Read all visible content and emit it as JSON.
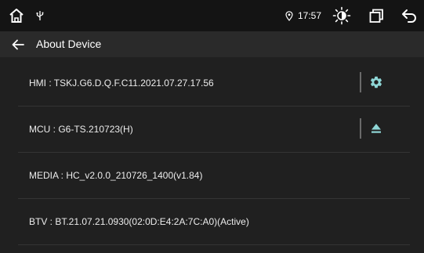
{
  "colors": {
    "status_bar_bg": "#141414",
    "title_bar_bg": "#2a2a2a",
    "page_bg": "#202020",
    "accent": "#8fd6d6",
    "divider": "#343434"
  },
  "status_bar": {
    "icons": [
      "home-icon",
      "usb-icon",
      "location-pin-icon",
      "brightness-icon",
      "recent-apps-icon",
      "back-icon"
    ],
    "time": "17:57"
  },
  "header": {
    "back_icon": "arrow-left-icon",
    "title": "About Device"
  },
  "rows": [
    {
      "label": "HMI : TSKJ.G6.D.Q.F.C11.2021.07.27.17.56",
      "action_icon": "gear-icon"
    },
    {
      "label": "MCU : G6-TS.210723(H)",
      "action_icon": "eject-icon"
    },
    {
      "label": "MEDIA : HC_v2.0.0_210726_1400(v1.84)"
    },
    {
      "label": "BTV : BT.21.07.21.0930(02:0D:E4:2A:7C:A0)(Active)"
    }
  ]
}
